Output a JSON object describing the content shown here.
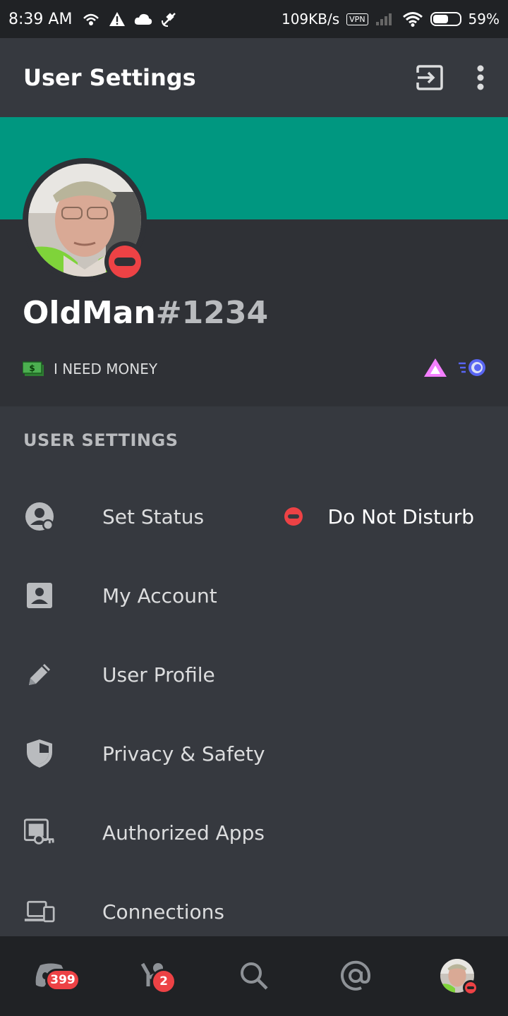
{
  "status_bar": {
    "time": "8:39 AM",
    "network_speed": "109KB/s",
    "vpn_label": "VPN",
    "battery": "59%",
    "battery_level": 0.59
  },
  "app_bar": {
    "title": "User Settings",
    "icons": [
      "logout-icon",
      "more-vertical-icon"
    ]
  },
  "profile": {
    "username": "OldMan",
    "discriminator": "#1234",
    "status": "dnd",
    "custom_status_emoji": "money-icon",
    "custom_status_text": "I NEED MONEY",
    "badges": [
      "hypesquad-brilliance-icon",
      "nitro-boost-icon"
    ],
    "banner_color": "#009780"
  },
  "settings": {
    "section_title": "USER SETTINGS",
    "items": [
      {
        "label": "Set Status",
        "icon": "status-person-icon",
        "value": "Do Not Disturb"
      },
      {
        "label": "My Account",
        "icon": "account-card-icon"
      },
      {
        "label": "User Profile",
        "icon": "pencil-icon"
      },
      {
        "label": "Privacy & Safety",
        "icon": "shield-icon"
      },
      {
        "label": "Authorized Apps",
        "icon": "apps-key-icon"
      },
      {
        "label": "Connections",
        "icon": "devices-icon"
      }
    ]
  },
  "bottom_nav": {
    "home_badge": "399",
    "friends_badge": "2",
    "items": [
      "home-icon",
      "friends-icon",
      "search-icon",
      "mentions-icon",
      "profile-avatar"
    ]
  },
  "colors": {
    "background": "#36393f",
    "secondary": "#2f3136",
    "tertiary": "#202225",
    "dnd_red": "#ed4245",
    "accent_green": "#009780"
  }
}
